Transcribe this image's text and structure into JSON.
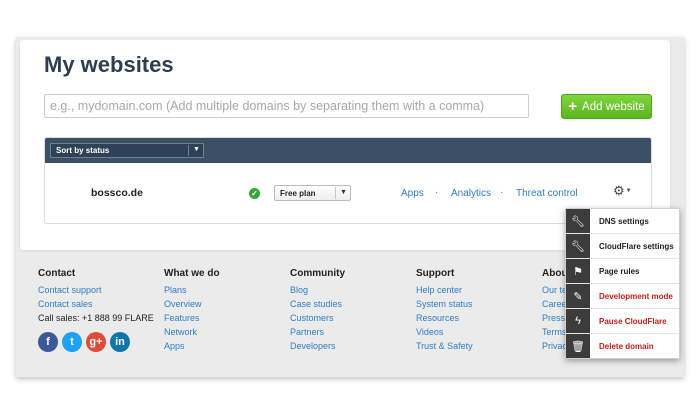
{
  "page": {
    "title": "My websites"
  },
  "add_domain": {
    "placeholder": "e.g., mydomain.com (Add multiple domains by separating them with a comma)",
    "button_label": "Add website",
    "button_icon": "plus-icon"
  },
  "sites_table": {
    "sort_label": "Sort by status",
    "rows": [
      {
        "domain": "bossco.de",
        "status_icon": "check-circle-icon",
        "status_color": "#35a834",
        "plan": "Free plan",
        "links": [
          "Apps",
          "Analytics",
          "Threat control"
        ],
        "separator": "·",
        "settings_icon": "gear-icon"
      }
    ]
  },
  "dropdown_menu": {
    "items": [
      {
        "label": "DNS settings",
        "icon": "wrench-icon",
        "color": "#222222"
      },
      {
        "label": "CloudFlare settings",
        "icon": "wrench-icon",
        "color": "#222222"
      },
      {
        "label": "Page rules",
        "icon": "page-rules-icon",
        "color": "#222222"
      },
      {
        "label": "Development mode",
        "icon": "pencil-icon",
        "color": "#c0201a"
      },
      {
        "label": "Pause CloudFlare",
        "icon": "pause-plug-icon",
        "color": "#c0201a"
      },
      {
        "label": "Delete domain",
        "icon": "trash-icon",
        "color": "#c0201a"
      }
    ]
  },
  "footer": {
    "columns": [
      {
        "heading": "Contact",
        "links": [
          "Contact support",
          "Contact sales"
        ],
        "text": "Call sales: +1 888 99 FLARE",
        "socials": [
          {
            "icon": "facebook-icon",
            "glyph": "f",
            "color": "#3b5998"
          },
          {
            "icon": "twitter-icon",
            "glyph": "t",
            "color": "#1da1f2"
          },
          {
            "icon": "google-plus-icon",
            "glyph": "g+",
            "color": "#dd4b39"
          },
          {
            "icon": "linkedin-icon",
            "glyph": "in",
            "color": "#0e76a8"
          }
        ]
      },
      {
        "heading": "What we do",
        "links": [
          "Plans",
          "Overview",
          "Features",
          "Network",
          "Apps"
        ]
      },
      {
        "heading": "Community",
        "links": [
          "Blog",
          "Case studies",
          "Customers",
          "Partners",
          "Developers"
        ]
      },
      {
        "heading": "Support",
        "links": [
          "Help center",
          "System status",
          "Resources",
          "Videos",
          "Trust & Safety"
        ]
      },
      {
        "heading": "Abou",
        "links": [
          "Our te",
          "Caree",
          "Press",
          "Terms",
          "Privac"
        ]
      }
    ]
  },
  "colors": {
    "accent_blue": "#2d7dc6",
    "header_navy": "#3b5066",
    "add_green": "#6cc52b",
    "danger_red": "#c0201a"
  }
}
